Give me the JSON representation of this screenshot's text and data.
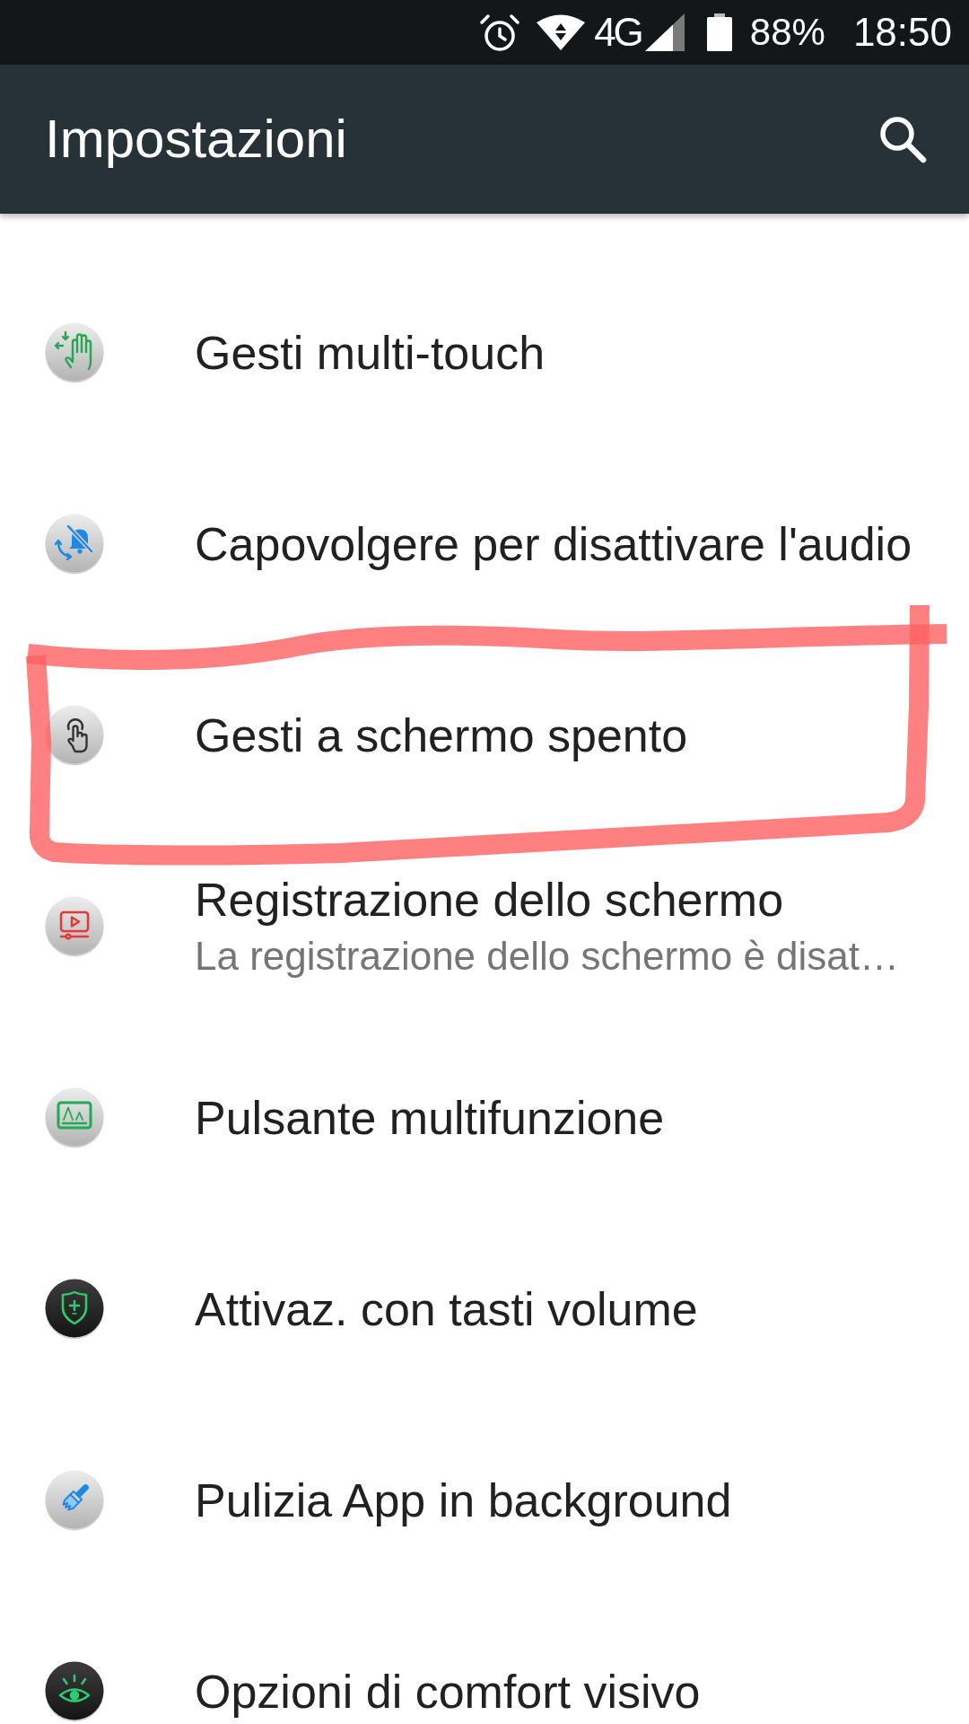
{
  "status_bar": {
    "network": "4G",
    "battery": "88%",
    "time": "18:50"
  },
  "app_bar": {
    "title": "Impostazioni"
  },
  "items": [
    {
      "title": "Gesti multi-touch",
      "circled": false
    },
    {
      "title": "Capovolgere per disattivare l'audio",
      "circled": false
    },
    {
      "title": "Gesti a schermo spento",
      "circled": true
    },
    {
      "title": "Registrazione dello schermo",
      "subtitle": "La registrazione dello schermo è disat…",
      "circled": false
    },
    {
      "title": "Pulsante multifunzione",
      "circled": false
    },
    {
      "title": "Attivaz. con tasti volume",
      "circled": false
    },
    {
      "title": "Pulizia App in background",
      "circled": false
    },
    {
      "title": "Opzioni di comfort visivo",
      "circled": false
    }
  ]
}
